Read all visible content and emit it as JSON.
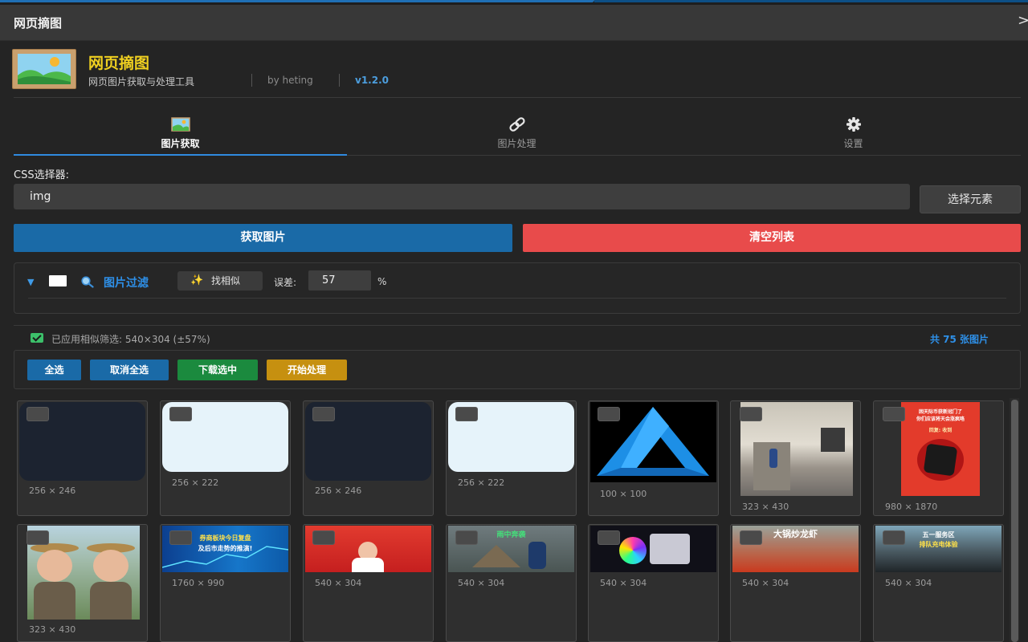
{
  "panel": {
    "title": "网页摘图",
    "close_icon": "chevron-right-icon",
    "close_glyph": ">"
  },
  "app": {
    "name": "网页摘图",
    "subtitle": "网页图片获取与处理工具",
    "author": "by heting",
    "version": "v1.2.0"
  },
  "tabs": [
    {
      "label": "图片获取",
      "icon": "image-icon",
      "active": true
    },
    {
      "label": "图片处理",
      "icon": "link-icon",
      "active": false
    },
    {
      "label": "设置",
      "icon": "gear-icon",
      "active": false
    }
  ],
  "selector": {
    "label": "CSS选择器:",
    "value": "img",
    "pick_button": "选择元素"
  },
  "buttons": {
    "fetch": "获取图片",
    "clear": "清空列表"
  },
  "filter": {
    "title": "图片过滤",
    "expanded": true,
    "checked": false,
    "similar_button": "找相似",
    "tolerance_label": "误差:",
    "tolerance_value": "57",
    "tolerance_unit": "%"
  },
  "status": {
    "applied": "已应用相似筛选: 540×304 (±57%)",
    "total": "共 75 张图片"
  },
  "actions": [
    {
      "label": "全选",
      "color": "#1a6aa7"
    },
    {
      "label": "取消全选",
      "color": "#1a6aa7"
    },
    {
      "label": "下载选中",
      "color": "#1b8a3e"
    },
    {
      "label": "开始处理",
      "color": "#c69010"
    }
  ],
  "images": [
    {
      "dims": "256 × 246",
      "preview": "dark"
    },
    {
      "dims": "256 × 222",
      "preview": "light"
    },
    {
      "dims": "256 × 246",
      "preview": "dark"
    },
    {
      "dims": "256 × 222",
      "preview": "light"
    },
    {
      "dims": "100 × 100",
      "preview": "blue-triangle-logo"
    },
    {
      "dims": "323 × 430",
      "preview": "street-photo"
    },
    {
      "dims": "980 × 1870",
      "preview": "red-poster",
      "caption_lines": [
        "困天际币获新冠门了",
        "你们应该将天会涨疯咯",
        "回复: 收到"
      ]
    },
    {
      "dims": "323 × 430",
      "preview": "two-children"
    },
    {
      "dims": "1760 × 990",
      "preview": "blue-finance-banner",
      "caption_lines": [
        "券商板块今日复盘",
        "及后市走势的推演!"
      ]
    },
    {
      "dims": "540 × 304",
      "preview": "red-news-banner"
    },
    {
      "dims": "540 × 304",
      "preview": "rain-scene",
      "caption_lines": [
        "雨中奔袭"
      ]
    },
    {
      "dims": "540 × 304",
      "preview": "dark-video-frame"
    },
    {
      "dims": "540 × 304",
      "preview": "crayfish-video",
      "caption_lines": [
        "大锅炒龙虾"
      ]
    },
    {
      "dims": "540 × 304",
      "preview": "car-interior",
      "caption_lines": [
        "五一服务区",
        "排队充电体验"
      ]
    }
  ]
}
